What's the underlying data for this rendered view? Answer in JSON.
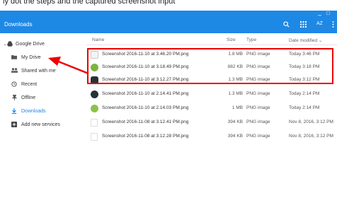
{
  "top_caption": "ly dot the steps and the captured screenshot  input",
  "window": {
    "minimize": "_",
    "maximize": "□"
  },
  "header": {
    "title": "Downloads"
  },
  "toolbar_icons": [
    "search-icon",
    "grid-view-icon",
    "sort-icon",
    "more-vert-icon"
  ],
  "sidebar": {
    "items": [
      {
        "label": "Google Drive",
        "icon": "drive-icon"
      },
      {
        "label": "My Drive",
        "icon": "folder-icon"
      },
      {
        "label": "Shared with me",
        "icon": "people-icon"
      },
      {
        "label": "Recent",
        "icon": "clock-icon"
      },
      {
        "label": "Offline",
        "icon": "pin-icon"
      },
      {
        "label": "Downloads",
        "icon": "download-icon"
      },
      {
        "label": "Add new services",
        "icon": "plus-icon"
      }
    ]
  },
  "columns": {
    "name": "Name",
    "size": "Size",
    "type": "Type",
    "date": "Date modified"
  },
  "files": [
    {
      "name": "Screenshot 2016-11-10 at 3.46.20 PM.png",
      "size": "1.8 MB",
      "type": "PNG image",
      "date": "Today 3:46 PM"
    },
    {
      "name": "Screenshot 2016-11-10 at 3.18.49 PM.png",
      "size": "882 KB",
      "type": "PNG image",
      "date": "Today 3:18 PM"
    },
    {
      "name": "Screenshot 2016-11-10 at 3.12.27 PM.png",
      "size": "1.3 MB",
      "type": "PNG image",
      "date": "Today 3:12 PM"
    },
    {
      "name": "Screenshot 2016-11-10 at 2.14.41 PM.png",
      "size": "1.3 MB",
      "type": "PNG image",
      "date": "Today 2:14 PM"
    },
    {
      "name": "Screenshot 2016-11-10 at 2.14.03 PM.png",
      "size": "1 MB",
      "type": "PNG image",
      "date": "Today 2:14 PM"
    },
    {
      "name": "Screenshot 2016-11-08 at 3.12.41 PM.png",
      "size": "394 KB",
      "type": "PNG image",
      "date": "Nov 8, 2016, 3:12 PM"
    },
    {
      "name": "Screenshot 2016-11-08 at 3.12.28 PM.png",
      "size": "394 KB",
      "type": "PNG image",
      "date": "Nov 8, 2016, 3:12 PM"
    }
  ],
  "colors": {
    "accent": "#1e88e5",
    "annotation": "#e00000"
  }
}
